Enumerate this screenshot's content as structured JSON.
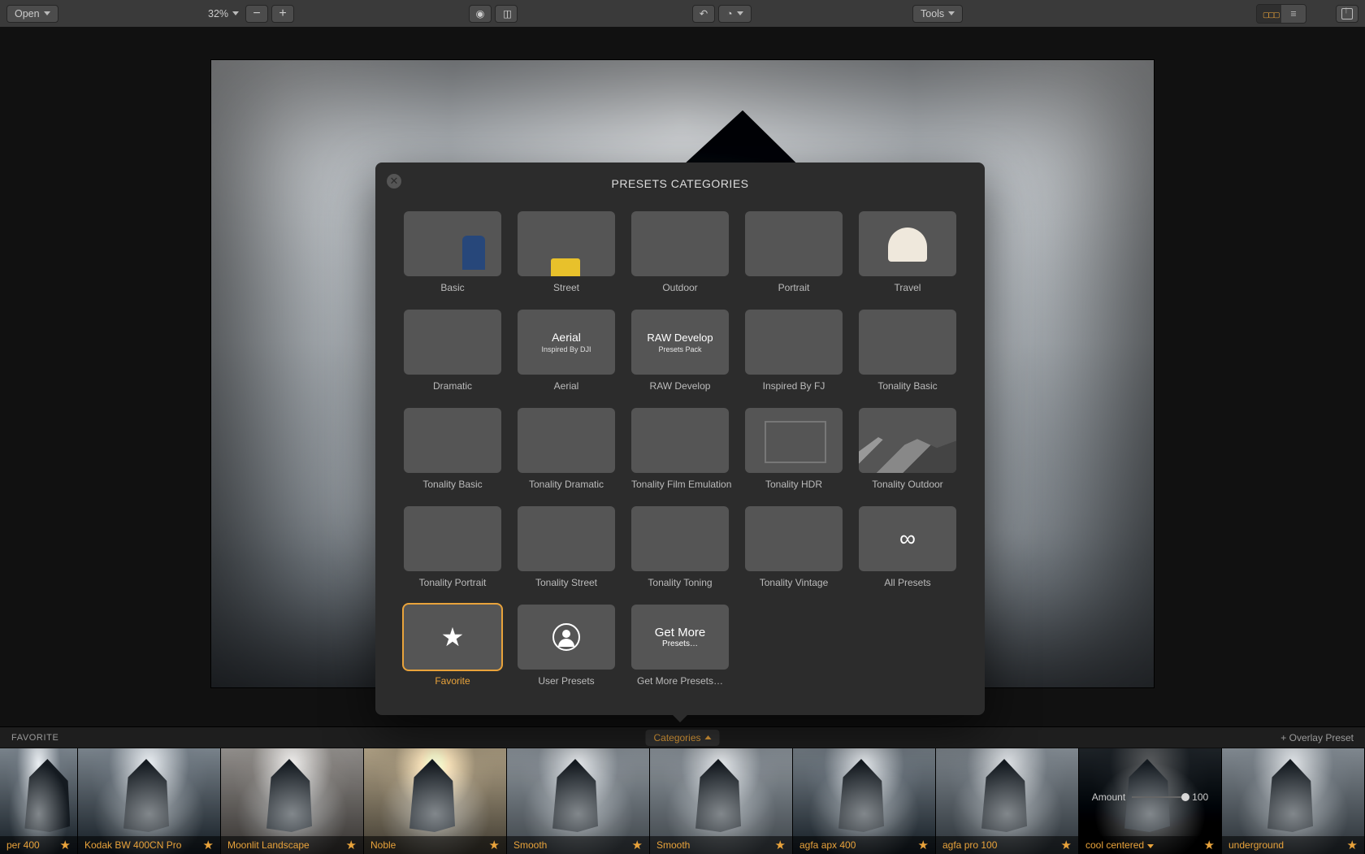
{
  "toolbar": {
    "open_label": "Open",
    "zoom_value": "32%",
    "tools_label": "Tools"
  },
  "modal": {
    "title": "PRESETS CATEGORIES",
    "aerial_overlay_title": "Aerial",
    "aerial_overlay_sub": "Inspired By DJI",
    "raw_overlay_title": "RAW Develop",
    "raw_overlay_sub": "Presets Pack",
    "getmore_overlay_title": "Get More",
    "getmore_overlay_sub": "Presets…",
    "categories": [
      {
        "label": "Basic"
      },
      {
        "label": "Street"
      },
      {
        "label": "Outdoor"
      },
      {
        "label": "Portrait"
      },
      {
        "label": "Travel"
      },
      {
        "label": "Dramatic"
      },
      {
        "label": "Aerial"
      },
      {
        "label": "RAW Develop"
      },
      {
        "label": "Inspired By FJ"
      },
      {
        "label": "Tonality Basic"
      },
      {
        "label": "Tonality Basic"
      },
      {
        "label": "Tonality Dramatic"
      },
      {
        "label": "Tonality Film Emulation"
      },
      {
        "label": "Tonality HDR"
      },
      {
        "label": "Tonality Outdoor"
      },
      {
        "label": "Tonality Portrait"
      },
      {
        "label": "Tonality Street"
      },
      {
        "label": "Tonality Toning"
      },
      {
        "label": "Tonality Vintage"
      },
      {
        "label": "All Presets"
      },
      {
        "label": "Favorite"
      },
      {
        "label": "User Presets"
      },
      {
        "label": "Get More Presets…"
      }
    ]
  },
  "preset_bar": {
    "section_label": "FAVORITE",
    "categories_label": "Categories",
    "overlay_label": "+ Overlay Preset",
    "amount_label": "Amount",
    "amount_value": "100",
    "presets": [
      {
        "name": "per 400"
      },
      {
        "name": "Kodak BW 400CN Pro"
      },
      {
        "name": "Moonlit Landscape"
      },
      {
        "name": "Noble"
      },
      {
        "name": "Smooth"
      },
      {
        "name": "Smooth"
      },
      {
        "name": "agfa apx 400"
      },
      {
        "name": "agfa pro 100"
      },
      {
        "name": "cool centered"
      },
      {
        "name": "underground"
      }
    ]
  }
}
